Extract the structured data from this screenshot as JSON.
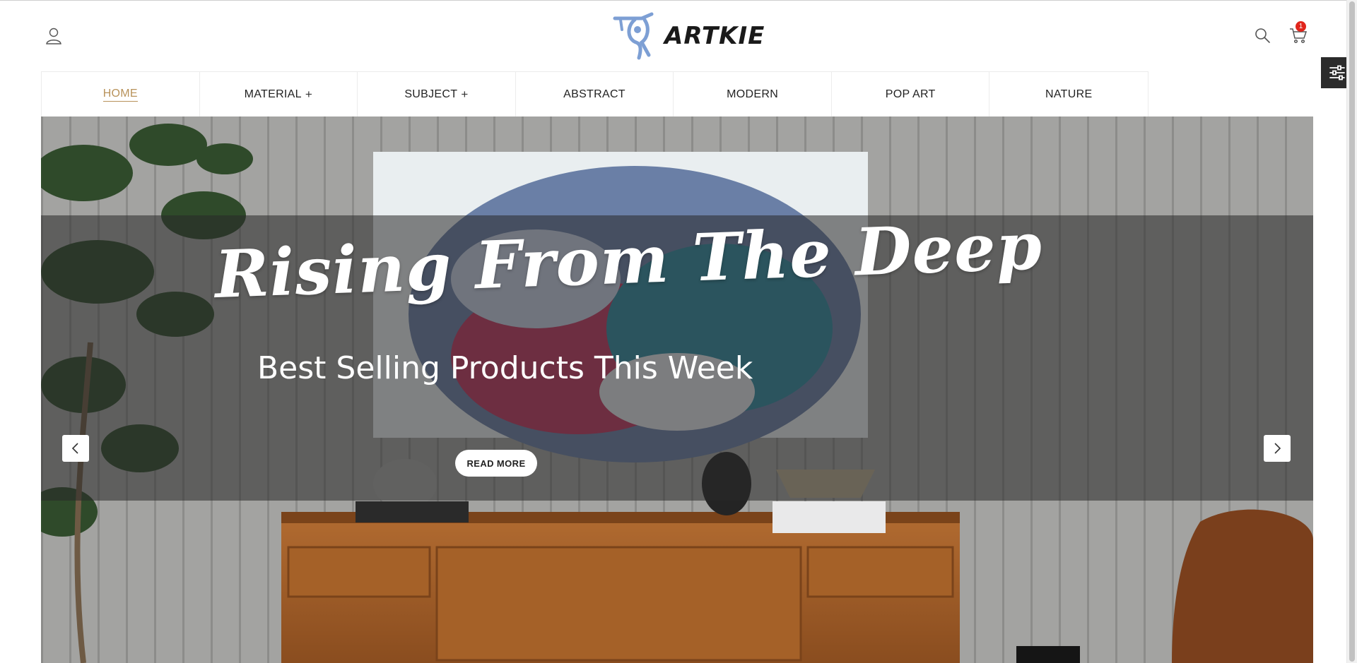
{
  "header": {
    "logo_text": "ARTKIE",
    "cart_count": "1",
    "icons": {
      "account": "user-icon",
      "search": "search-icon",
      "cart": "cart-icon",
      "settings": "sliders-icon"
    }
  },
  "nav": {
    "items": [
      {
        "label": "HOME",
        "active": true,
        "has_submenu": false
      },
      {
        "label": "MATERIAL",
        "active": false,
        "has_submenu": true
      },
      {
        "label": "SUBJECT",
        "active": false,
        "has_submenu": true
      },
      {
        "label": "ABSTRACT",
        "active": false,
        "has_submenu": false
      },
      {
        "label": "MODERN",
        "active": false,
        "has_submenu": false
      },
      {
        "label": "POP ART",
        "active": false,
        "has_submenu": false
      },
      {
        "label": "NATURE",
        "active": false,
        "has_submenu": false
      }
    ],
    "submenu_symbol": "+"
  },
  "hero": {
    "title": "Rising From The Deep",
    "subtitle": "Best Selling Products This Week",
    "button_label": "READ MORE"
  },
  "colors": {
    "accent": "#b8925a",
    "badge": "#e1251b",
    "logo_blue": "#7d9fd4",
    "settings_tab": "#2b2b2b"
  }
}
